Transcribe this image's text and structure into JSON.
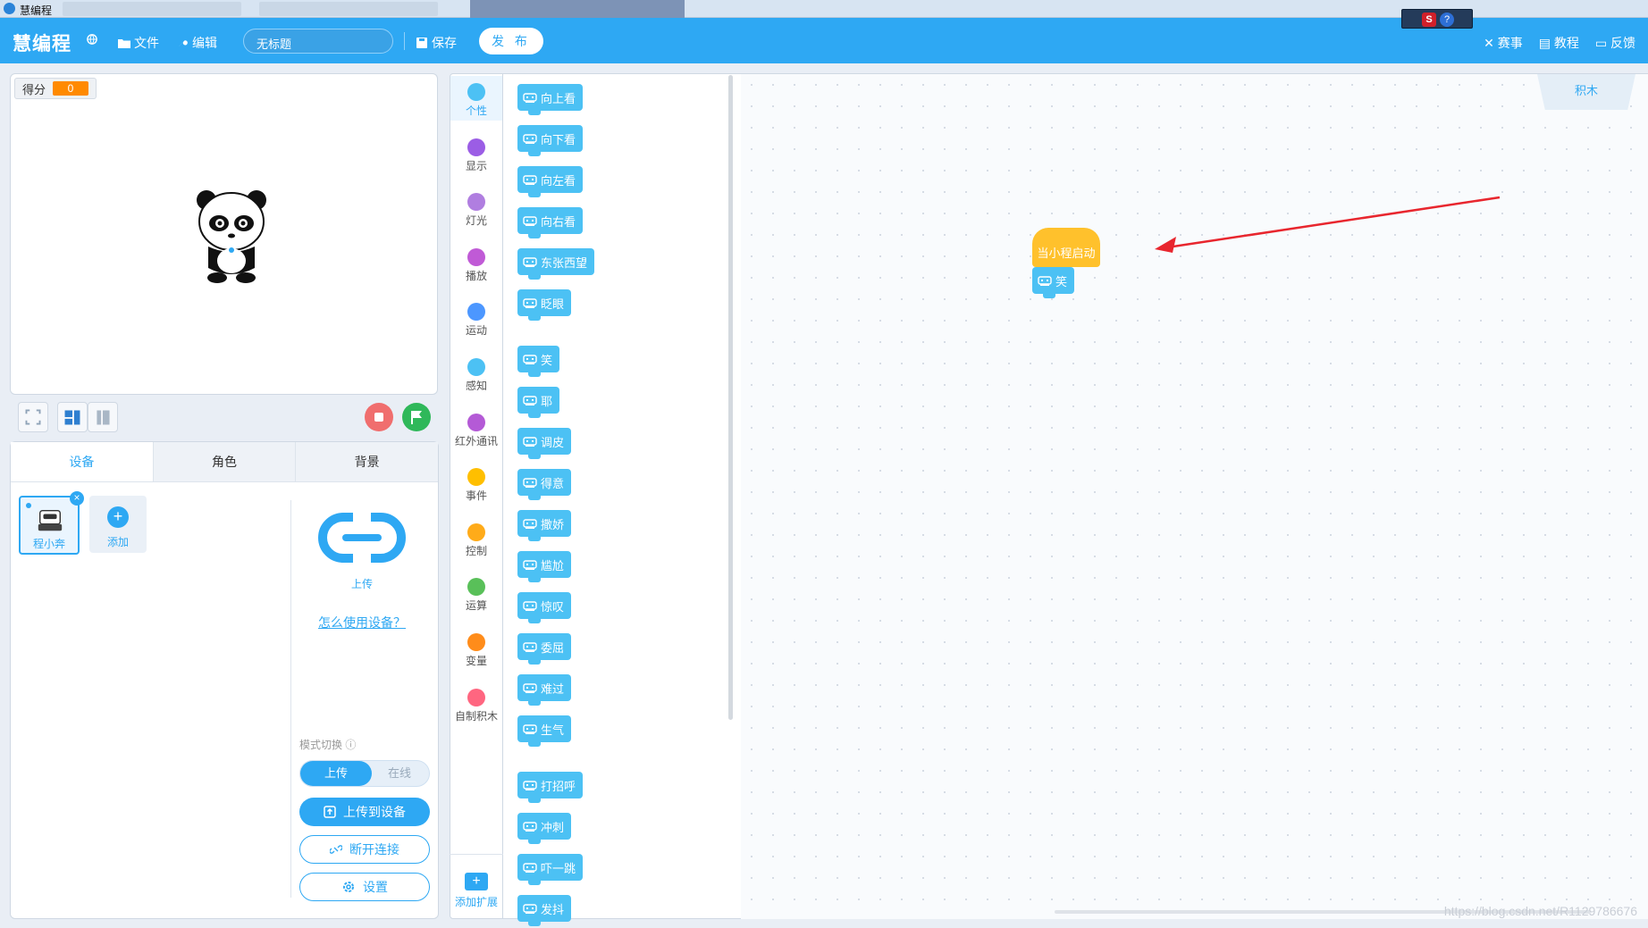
{
  "window": {
    "title": "慧编程"
  },
  "topbar": {
    "brand": "慧编程",
    "file": "文件",
    "edit": "编辑",
    "project_name": "无标题",
    "save": "保存",
    "publish": "发 布",
    "contest": "赛事",
    "tutorial": "教程",
    "feedback": "反馈"
  },
  "stage": {
    "score_label": "得分",
    "score_value": "0"
  },
  "panel": {
    "tabs": [
      "设备",
      "角色",
      "背景"
    ],
    "device_name": "程小奔",
    "add_label": "添加",
    "upload_label": "上传",
    "howto_link": "怎么使用设备？",
    "mode_label": "模式切换",
    "mode_on": "上传",
    "mode_off": "在线",
    "upload_to_device": "上传到设备",
    "disconnect": "断开连接",
    "settings": "设置"
  },
  "categories": [
    {
      "label": "个性",
      "color": "#4cc1f4"
    },
    {
      "label": "显示",
      "color": "#9b5de5"
    },
    {
      "label": "灯光",
      "color": "#b07ee0"
    },
    {
      "label": "播放",
      "color": "#c05ad6"
    },
    {
      "label": "运动",
      "color": "#4c97ff"
    },
    {
      "label": "感知",
      "color": "#4cc1f4"
    },
    {
      "label": "红外通讯",
      "color": "#b45ad6"
    },
    {
      "label": "事件",
      "color": "#ffbf00"
    },
    {
      "label": "控制",
      "color": "#ffab19"
    },
    {
      "label": "运算",
      "color": "#59c059"
    },
    {
      "label": "变量",
      "color": "#ff8c1a"
    },
    {
      "label": "自制积木",
      "color": "#ff6680"
    }
  ],
  "add_extension": "添加扩展",
  "blocks": [
    "向上看",
    "向下看",
    "向左看",
    "向右看",
    "东张西望",
    "眨眼",
    "笑",
    "耶",
    "调皮",
    "得意",
    "撒娇",
    "尴尬",
    "惊叹",
    "委屈",
    "难过",
    "生气",
    "打招呼",
    "冲刺",
    "吓一跳",
    "发抖"
  ],
  "canvas": {
    "blocks_tab": "积木",
    "hat_block": "当小程启动",
    "stack_block": "笑",
    "watermark": "https://blog.csdn.net/R1129786676"
  },
  "colors": {
    "accent": "#2ea8f3",
    "block_blue": "#4cc1f4",
    "event_yellow": "#ffc12c",
    "stop_red": "#f06e6e",
    "go_green": "#2fb85a",
    "score_orange": "#ff8a00"
  }
}
